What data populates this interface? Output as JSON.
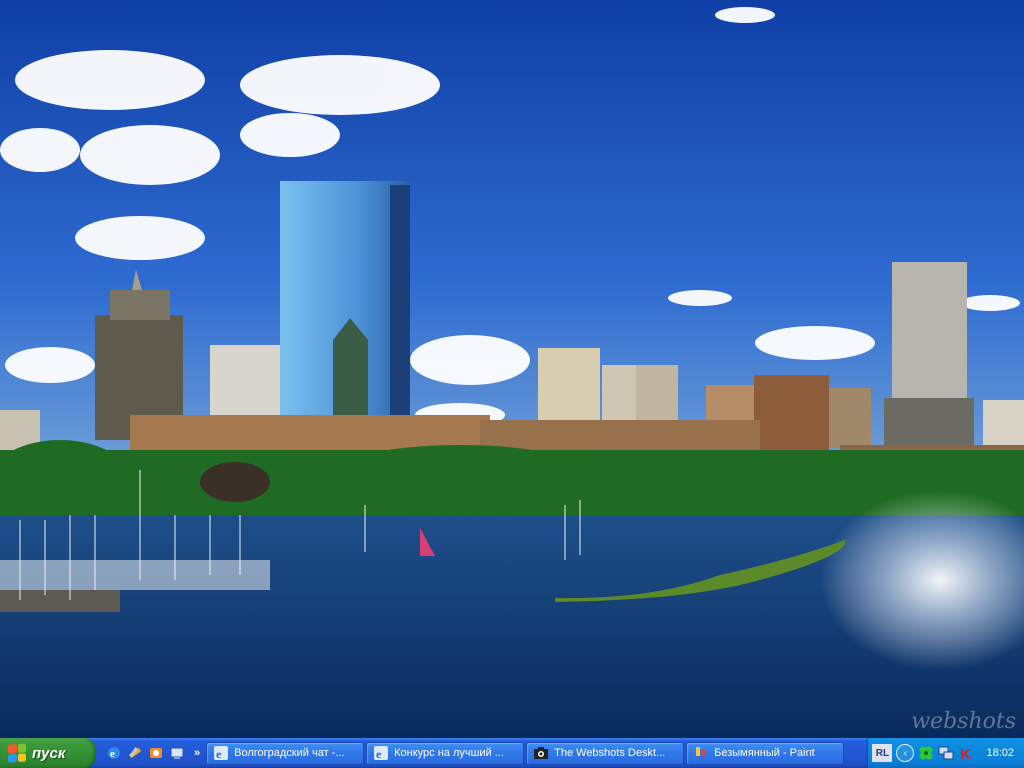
{
  "desktop": {
    "watermark": "webshots"
  },
  "taskbar": {
    "start_label": "пуск",
    "quicklaunch_more": "»",
    "tasks": [
      {
        "label": "Волгоградский чат -...",
        "icon": "ie-icon"
      },
      {
        "label": "Конкурс на лучший ...",
        "icon": "ie-icon"
      },
      {
        "label": "The Webshots Deskt...",
        "icon": "camera-icon"
      },
      {
        "label": "Безымянный - Paint",
        "icon": "paint-icon"
      }
    ],
    "tray": {
      "language": "RL",
      "clock": "18:02"
    }
  },
  "colors": {
    "taskbar_blue": "#245edb",
    "start_green": "#3c9a3c",
    "tray_blue": "#0b7fd8"
  }
}
